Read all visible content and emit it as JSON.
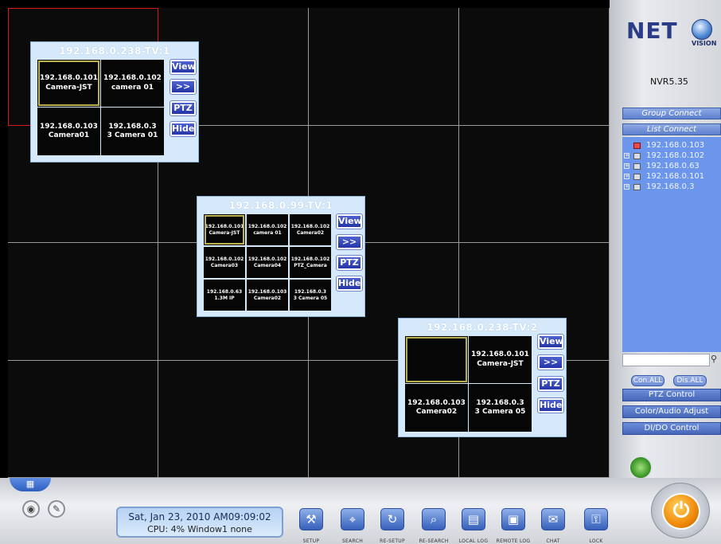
{
  "tv_windows": [
    {
      "title": "192.168.0.238-TV:1",
      "tiles": [
        {
          "line1": "192.168.0.101",
          "line2": "Camera-JST",
          "selected": true
        },
        {
          "line1": "192.168.0.102",
          "line2": "camera 01"
        },
        {
          "line1": "192.168.0.103",
          "line2": "Camera01"
        },
        {
          "line1": "192.168.0.3",
          "line2": "3 Camera 01"
        }
      ]
    },
    {
      "title": "192.168.0.99-TV:1",
      "tiles": [
        {
          "line1": "192.168.0.101",
          "line2": "Camera-JST",
          "selected": true
        },
        {
          "line1": "192.168.0.102",
          "line2": "camera 01"
        },
        {
          "line1": "192.168.0.102",
          "line2": "Camera02"
        },
        {
          "line1": "192.168.0.102",
          "line2": "Camera03"
        },
        {
          "line1": "192.168.0.102",
          "line2": "Camera04"
        },
        {
          "line1": "192.168.0.102",
          "line2": "PTZ_Camera"
        },
        {
          "line1": "192.168.0.63",
          "line2": "1.3M IP"
        },
        {
          "line1": "192.168.0.103",
          "line2": "Camera02"
        },
        {
          "line1": "192.168.0.3",
          "line2": "3 Camera 05"
        }
      ]
    },
    {
      "title": "192.168.0.238-TV:2",
      "tiles": [
        {
          "line1": "",
          "line2": "",
          "selected": true
        },
        {
          "line1": "192.168.0.101",
          "line2": "Camera-JST"
        },
        {
          "line1": "192.168.0.103",
          "line2": "Camera02"
        },
        {
          "line1": "192.168.0.3",
          "line2": "3 Camera 05"
        }
      ]
    }
  ],
  "tv_buttons": {
    "view": "View",
    "next": ">>",
    "ptz": "PTZ",
    "hide": "Hide"
  },
  "right_panel": {
    "logo_text": "NET",
    "logo_sub": "VISION",
    "version": "NVR5.35",
    "group_connect": "Group Connect",
    "list_connect": "List Connect",
    "devices": [
      {
        "ip": "192.168.0.103",
        "icon": "connected-pc-icon",
        "color": "#e94b4b"
      },
      {
        "ip": "192.168.0.102",
        "icon": "pc-icon"
      },
      {
        "ip": "192.168.0.63",
        "icon": "pc-icon"
      },
      {
        "ip": "192.168.0.101",
        "icon": "pc-icon"
      },
      {
        "ip": "192.168.0.3",
        "icon": "pc-icon"
      }
    ],
    "con_all": "Con.ALL",
    "dis_all": "Dis.ALL",
    "sections": [
      "PTZ Control",
      "Color/Audio Adjust",
      "DI/DO Control"
    ]
  },
  "status": {
    "datetime": "Sat, Jan 23, 2010   AM09:09:02",
    "cpu": "CPU: 4%  Window1  none"
  },
  "toolbar": [
    {
      "label": "SETUP",
      "icon": "setup-icon"
    },
    {
      "label": "SEARCH",
      "icon": "search-icon"
    },
    {
      "label": "RE-SETUP",
      "icon": "re-setup-icon"
    },
    {
      "label": "RE-SEARCH",
      "icon": "re-search-icon"
    },
    {
      "label": "LOCAL LOG",
      "icon": "local-log-icon"
    },
    {
      "label": "REMOTE LOG",
      "icon": "remote-log-icon"
    },
    {
      "label": "CHAT",
      "icon": "chat-icon"
    },
    {
      "label": "LOCK",
      "icon": "lock-icon"
    }
  ],
  "colors": {
    "grid_border": "#9a9a9a",
    "selected_cell": "#d21c1c",
    "popup_bg": "#d6e9fb",
    "button_blue": "#2f42b5"
  }
}
